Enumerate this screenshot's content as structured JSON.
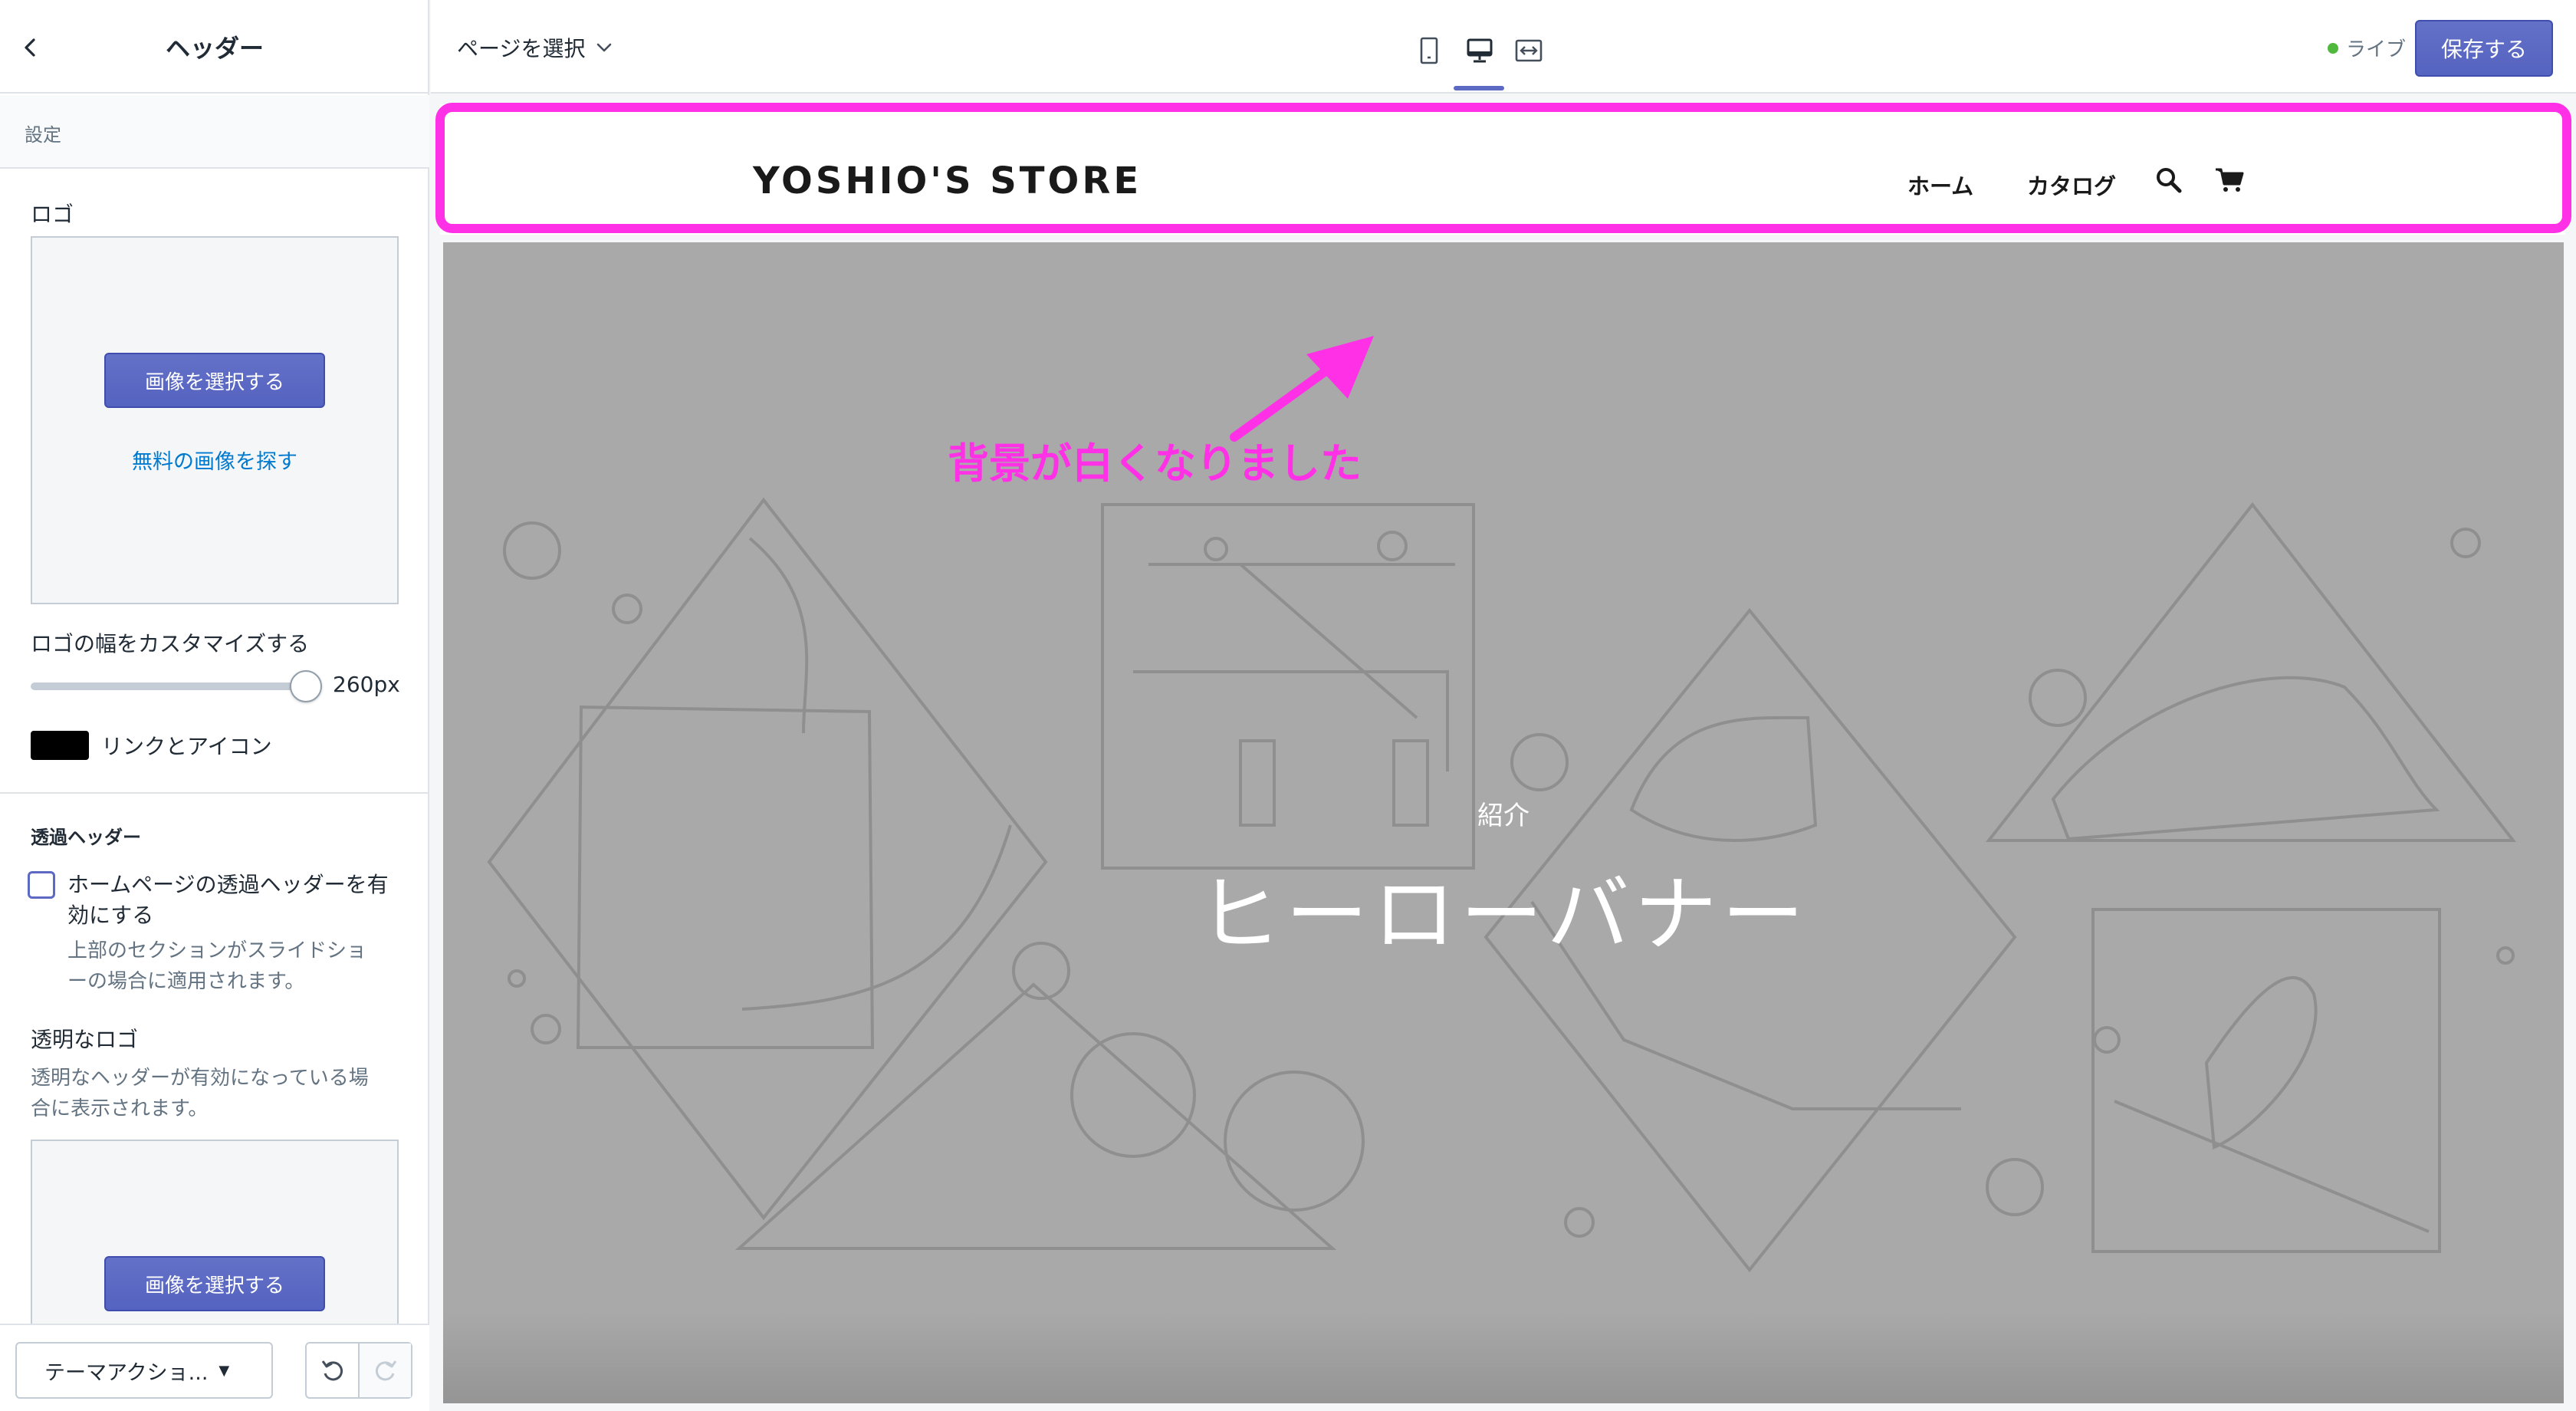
{
  "sidebar": {
    "title": "ヘッダー",
    "section_label": "設定",
    "logo": {
      "label": "ロゴ",
      "select_button": "画像を選択する",
      "free_link": "無料の画像を探す"
    },
    "logo_width": {
      "label": "ロゴの幅をカスタマイズする",
      "value": "260px"
    },
    "link_icon": {
      "label": "リンクとアイコン",
      "color": "#000000"
    },
    "transparent_header": {
      "heading": "透過ヘッダー",
      "checkbox_line1": "ホームページの透過ヘッダーを有",
      "checkbox_line2": "効にする",
      "checked": false,
      "help_line1": "上部のセクションがスライドショ",
      "help_line2": "ーの場合に適用されます。"
    },
    "transparent_logo": {
      "label": "透明なロゴ",
      "help_line1": "透明なヘッダーが有効になっている場",
      "help_line2": "合に表示されます。",
      "select_button": "画像を選択する"
    },
    "footer": {
      "theme_actions": "テーマアクショ..."
    }
  },
  "topbar": {
    "page_select": "ページを選択",
    "active_device": "desktop",
    "status": "ライブ",
    "save": "保存する"
  },
  "preview": {
    "store_name": "YOSHIO'S STORE",
    "nav": [
      "ホーム",
      "カタログ"
    ],
    "hero_subtitle": "紹介",
    "hero_title": "ヒーローバナー"
  },
  "annotation": {
    "text": "背景が白くなりました",
    "color": "#ff30e6"
  },
  "colors": {
    "accent": "#5c6ac4",
    "live": "#50b83c",
    "link": "#007ace",
    "hero_bg": "#a9a9a9"
  }
}
